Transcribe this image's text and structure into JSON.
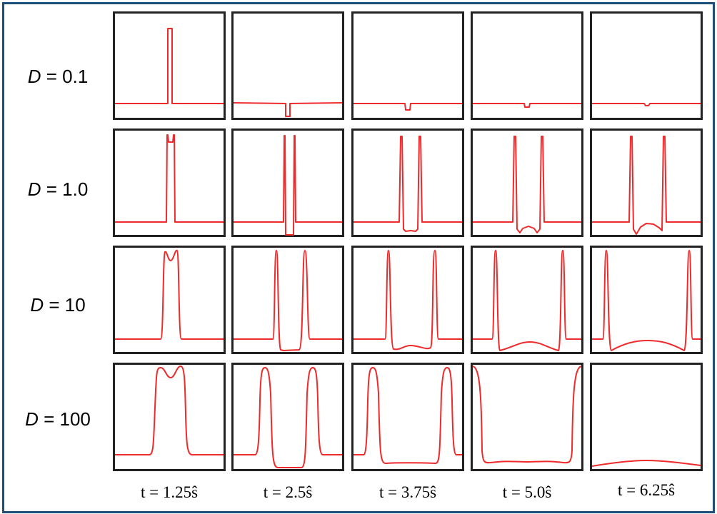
{
  "rows": [
    {
      "var": "D",
      "rest": " = 0.1"
    },
    {
      "var": "D",
      "rest": " = 1.0"
    },
    {
      "var": "D",
      "rest": " = 10"
    },
    {
      "var": "D",
      "rest": " = 100"
    }
  ],
  "columns": [
    "t = 1.25ŝ",
    "t = 2.5ŝ",
    "t = 3.75ŝ",
    "t = 5.0ŝ",
    "t = 6.25ŝ"
  ],
  "colors": {
    "curve": "#ee2a2a",
    "panel_border": "#222222",
    "frame_border": "#1f4e79"
  }
}
